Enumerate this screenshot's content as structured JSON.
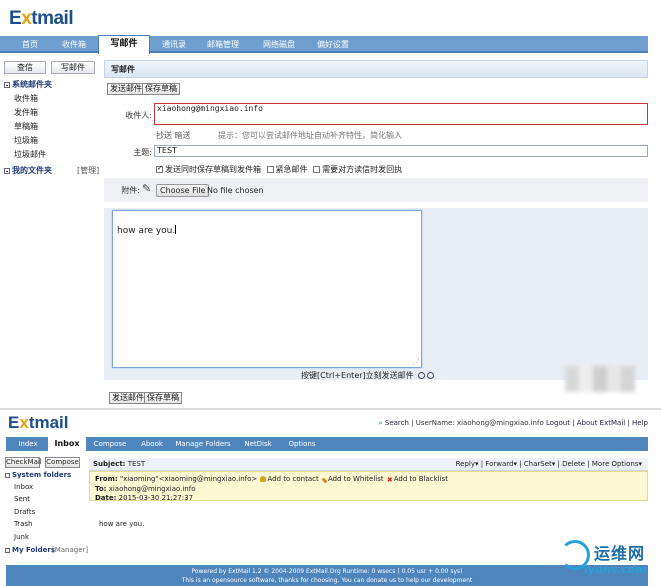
{
  "top": {
    "logo": {
      "prefix": "E",
      "mark": "x",
      "suffix": "tmail"
    },
    "nav": [
      "首页",
      "收件箱",
      "写邮件",
      "通讯录",
      "邮箱管理",
      "网络磁盘",
      "偏好设置"
    ],
    "active_nav": "写邮件",
    "sidebar": {
      "query_btn": "查信",
      "compose_btn": "写邮件",
      "system_folders": "系统邮件夹",
      "folders": [
        "收件箱",
        "发件箱",
        "草稿箱",
        "垃圾箱",
        "垃圾邮件"
      ],
      "my_folders": "我的文件夹",
      "manage": "[管理]"
    },
    "compose": {
      "title": "写邮件",
      "send_btn": "发送邮件",
      "save_draft_btn": "保存草稿",
      "to_label": "收件人:",
      "to_value": "xiaohong@mingxiao.info",
      "cc_bcc": "抄送 暗送",
      "hint": "提示：您可以尝试邮件地址自动补齐特性，简化输入",
      "subject_label": "主题:",
      "subject_value": "TEST",
      "option_save_sent": "发送同时保存草稿到发件箱",
      "option_urgent": "紧急邮件",
      "option_receipt": "需要对方读信时发回执",
      "attach_label": "附件:",
      "choose_file": "Choose File",
      "no_file": "No file chosen",
      "body": "how are you.",
      "shortcut": "按键[Ctrl+Enter]立刻发送邮件",
      "send_btn_bottom": "发送邮件",
      "save_draft_btn_bottom": "保存草稿"
    }
  },
  "bottom": {
    "logo": {
      "prefix": "E",
      "mark": "x",
      "suffix": "tmail"
    },
    "search": "Search",
    "username_label": "UserName:",
    "username": "xiaohong@mingxiao.info",
    "logout": "Logout",
    "about": "About ExtMail",
    "help": "Help",
    "nav": [
      "Index",
      "Inbox",
      "Compose",
      "Abook",
      "Manage Folders",
      "NetDisk",
      "Options"
    ],
    "active_nav": "Inbox",
    "sidebar": {
      "check_btn": "CheckMail",
      "compose_btn": "Compose",
      "system_folders": "System folders",
      "folders": [
        "Inbox",
        "Sent",
        "Drafts",
        "Trash",
        "Junk"
      ],
      "my_folders": "My Folders",
      "manager": "[Manager]"
    },
    "message": {
      "subject_label": "Subject:",
      "subject": "TEST",
      "actions": "Reply▾ | Forward▾ | CharSet▾ | Delete | More Options▾",
      "from_label": "From:",
      "from": "\"xiaoming\"<xiaoming@mingxiao.info>",
      "add_contact": "Add to contact",
      "add_whitelist": "Add to Whitelist",
      "add_blacklist": "Add to Blacklist",
      "to_label": "To:",
      "to": "xiaohong@mingxiao.info",
      "date_label": "Date:",
      "date": "2015-03-30 21:27:37",
      "body": "how are you."
    },
    "footer": {
      "line1": "Powered by ExtMail 1.2 © 2004-2009 ExtMail.Org Runtime: 0 wsecs ( 0.05 usr + 0.00 sys)",
      "line2": "This is an opensource software, thanks for choosing. You can donate us to help our development"
    }
  },
  "watermark": {
    "cn": "运维网",
    "url": "iyunv.com"
  },
  "colors": {
    "nav_top": "#6e9fce",
    "nav_bottom": "#4f85bd",
    "header_box": "#fbf8d2",
    "logo_blue": "#1b4f8c",
    "logo_orange": "#e8a10d"
  }
}
